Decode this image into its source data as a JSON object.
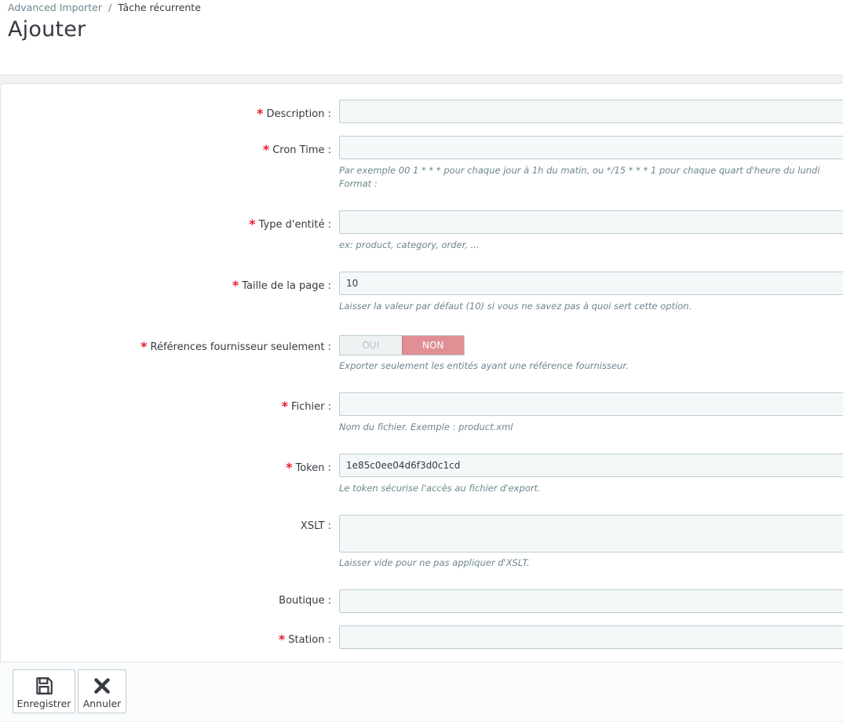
{
  "breadcrumb": {
    "parent": "Advanced Importer",
    "separator": "/",
    "current": "Tâche récurrente"
  },
  "page_title": "Ajouter",
  "form": {
    "description": {
      "label": "Description :",
      "value": ""
    },
    "cron_time": {
      "label": "Cron Time :",
      "value": "",
      "help_line1": "Par exemple 00 1 * * * pour chaque jour à 1h du matin, ou */15 * * * 1 pour chaque quart d'heure du lundi",
      "help_line2": "Format :"
    },
    "entity_type": {
      "label": "Type d'entité :",
      "value": "",
      "help": "ex: product, category, order, ..."
    },
    "page_size": {
      "label": "Taille de la page :",
      "value": "10",
      "help": "Laisser la valeur par défaut (10) si vous ne savez pas à quoi sert cette option."
    },
    "supplier_refs": {
      "label": "Références fournisseur seulement :",
      "yes_label": "OUI",
      "no_label": "NON",
      "selected": "NON",
      "help": "Exporter seulement les entités ayant une référence fournisseur."
    },
    "file": {
      "label": "Fichier :",
      "value": "",
      "help": "Nom du fichier. Exemple : product.xml"
    },
    "token": {
      "label": "Token :",
      "value": "1e85c0ee04d6f3d0c1cd",
      "help": "Le token sécurise l'accès au fichier d'export."
    },
    "xslt": {
      "label": "XSLT :",
      "value": "",
      "help": "Laisser vide pour ne pas appliquer d'XSLT."
    },
    "shop": {
      "label": "Boutique :",
      "value": ""
    },
    "station": {
      "label": "Station :",
      "value": ""
    },
    "required_mark": "*"
  },
  "footer": {
    "save_label": "Enregistrer",
    "cancel_label": "Annuler"
  },
  "colors": {
    "required": "#ea1c2d",
    "switch_active": "#e08f95",
    "help_text": "#6c868e"
  }
}
